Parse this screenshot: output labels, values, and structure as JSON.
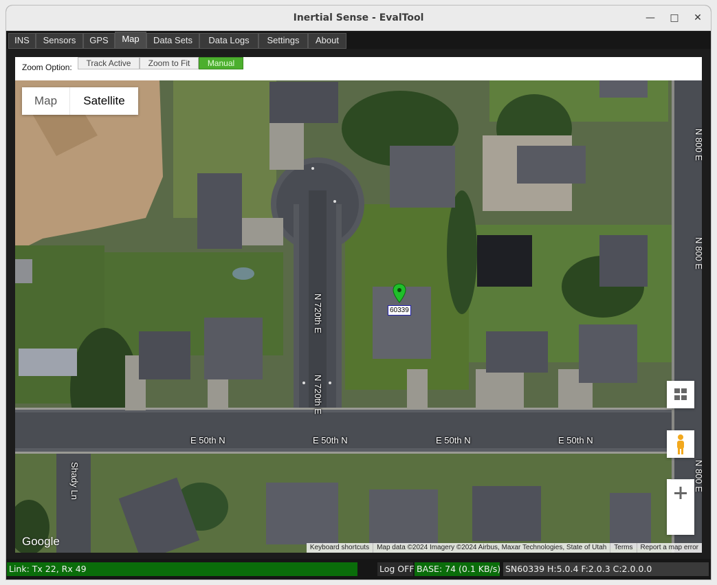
{
  "window": {
    "title": "Inertial Sense - EvalTool"
  },
  "tabs": [
    {
      "label": "INS"
    },
    {
      "label": "Sensors"
    },
    {
      "label": "GPS"
    },
    {
      "label": "Map"
    },
    {
      "label": "Data Sets"
    },
    {
      "label": "Data Logs"
    },
    {
      "label": "Settings"
    },
    {
      "label": "About"
    }
  ],
  "active_tab": "Map",
  "zoom": {
    "label": "Zoom Option:",
    "options": [
      "Track Active",
      "Zoom to Fit",
      "Manual"
    ],
    "selected": "Manual"
  },
  "map": {
    "type_buttons": [
      "Map",
      "Satellite"
    ],
    "selected_type": "Satellite",
    "marker_label": "60339",
    "road_labels": {
      "street_h": "E 50th N",
      "street_v": "N 720th E",
      "shady": "Shady Ln",
      "edge": "N 800 E"
    },
    "logo": "Google",
    "attribution": [
      "Keyboard shortcuts",
      "Map data ©2024 Imagery ©2024 Airbus, Maxar Technologies, State of Utah",
      "Terms",
      "Report a map error"
    ],
    "icons": [
      "fullscreen-icon",
      "pegman-icon",
      "zoom-in-icon",
      "zoom-out-icon",
      "map-pin-icon"
    ]
  },
  "status": {
    "link": "Link: Tx 22, Rx 49",
    "log": "Log OFF",
    "base": "BASE: 74  (0.1 KB/s)",
    "device": "SN60339 H:5.0.4  F:2.0.3  C:2.0.0.0"
  },
  "colors": {
    "link_bg": "#0a6d0a",
    "base_bg": "#0a6d0a",
    "manual_selected": "#4caf2e"
  }
}
